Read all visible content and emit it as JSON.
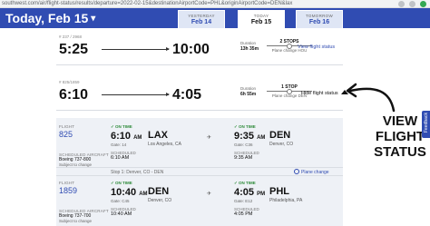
{
  "browser": {
    "url": "southwest.com/air/flight-status/results/departure=2022-02-15&destinationAirportCode=PHL&originAirportCode=DEN&lax"
  },
  "header": {
    "date_label": "Today, Feb 15",
    "days": [
      {
        "label": "YESTERDAY",
        "date": "Feb 14"
      },
      {
        "label": "TODAY",
        "date": "Feb 15"
      },
      {
        "label": "TOMORROW",
        "date": "Feb 16"
      }
    ]
  },
  "flights": [
    {
      "number": "# 237 / 2968",
      "depart": "5:25",
      "arrive": "10:00",
      "duration_label": "Duration",
      "duration": "13h 35m",
      "stops": "2 STOPS",
      "change": "Plane change HOU",
      "link": "View flight status"
    },
    {
      "number": "# 825/1859",
      "depart": "6:10",
      "arrive": "4:05",
      "duration_label": "Duration",
      "duration": "6h 55m",
      "stops": "1 STOP",
      "change": "Plane change DEN",
      "link": "Hide flight status"
    }
  ],
  "segments": [
    {
      "flight_label": "FLIGHT",
      "flight": "825",
      "aircraft_label": "SCHEDULED AIRCRAFT",
      "aircraft": "Boeing 737-800",
      "subject": "Subject to change",
      "dep_status": "ON TIME",
      "dep_time": "6:10",
      "dep_ampm": "AM",
      "dep_gate": "Gate: 14",
      "dep_sched_label": "SCHEDULED",
      "dep_sched": "6:10 AM",
      "origin": "LAX",
      "origin_city": "Los Angeles, CA",
      "arr_status": "ON TIME",
      "arr_time": "9:35",
      "arr_ampm": "AM",
      "arr_gate": "Gate: C36",
      "arr_sched_label": "SCHEDULED",
      "arr_sched": "9:35 AM",
      "dest": "DEN",
      "dest_city": "Denver, CO"
    },
    {
      "flight_label": "FLIGHT",
      "flight": "1859",
      "aircraft_label": "SCHEDULED AIRCRAFT",
      "aircraft": "Boeing 737-700",
      "subject": "Subject to change",
      "dep_status": "ON TIME",
      "dep_time": "10:40",
      "dep_ampm": "AM",
      "dep_gate": "Gate: C45",
      "dep_sched_label": "SCHEDULED",
      "dep_sched": "10:40 AM",
      "origin": "DEN",
      "origin_city": "Denver, CO",
      "arr_status": "ON TIME",
      "arr_time": "4:05",
      "arr_ampm": "PM",
      "arr_gate": "Gate: E12",
      "arr_sched_label": "SCHEDULED",
      "arr_sched": "4:05 PM",
      "dest": "PHL",
      "dest_city": "Philadelphia, PA"
    }
  ],
  "stopover": {
    "text": "Stop 1: Denver, CO - DEN",
    "plane_change": "Plane change"
  },
  "annotation": {
    "line1": "VIEW",
    "line2": "FLIGHT",
    "line3": "STATUS"
  },
  "side_tab": "Feedback",
  "colors": {
    "brand_blue": "#304cb2",
    "on_time_green": "#2e8b3a"
  }
}
